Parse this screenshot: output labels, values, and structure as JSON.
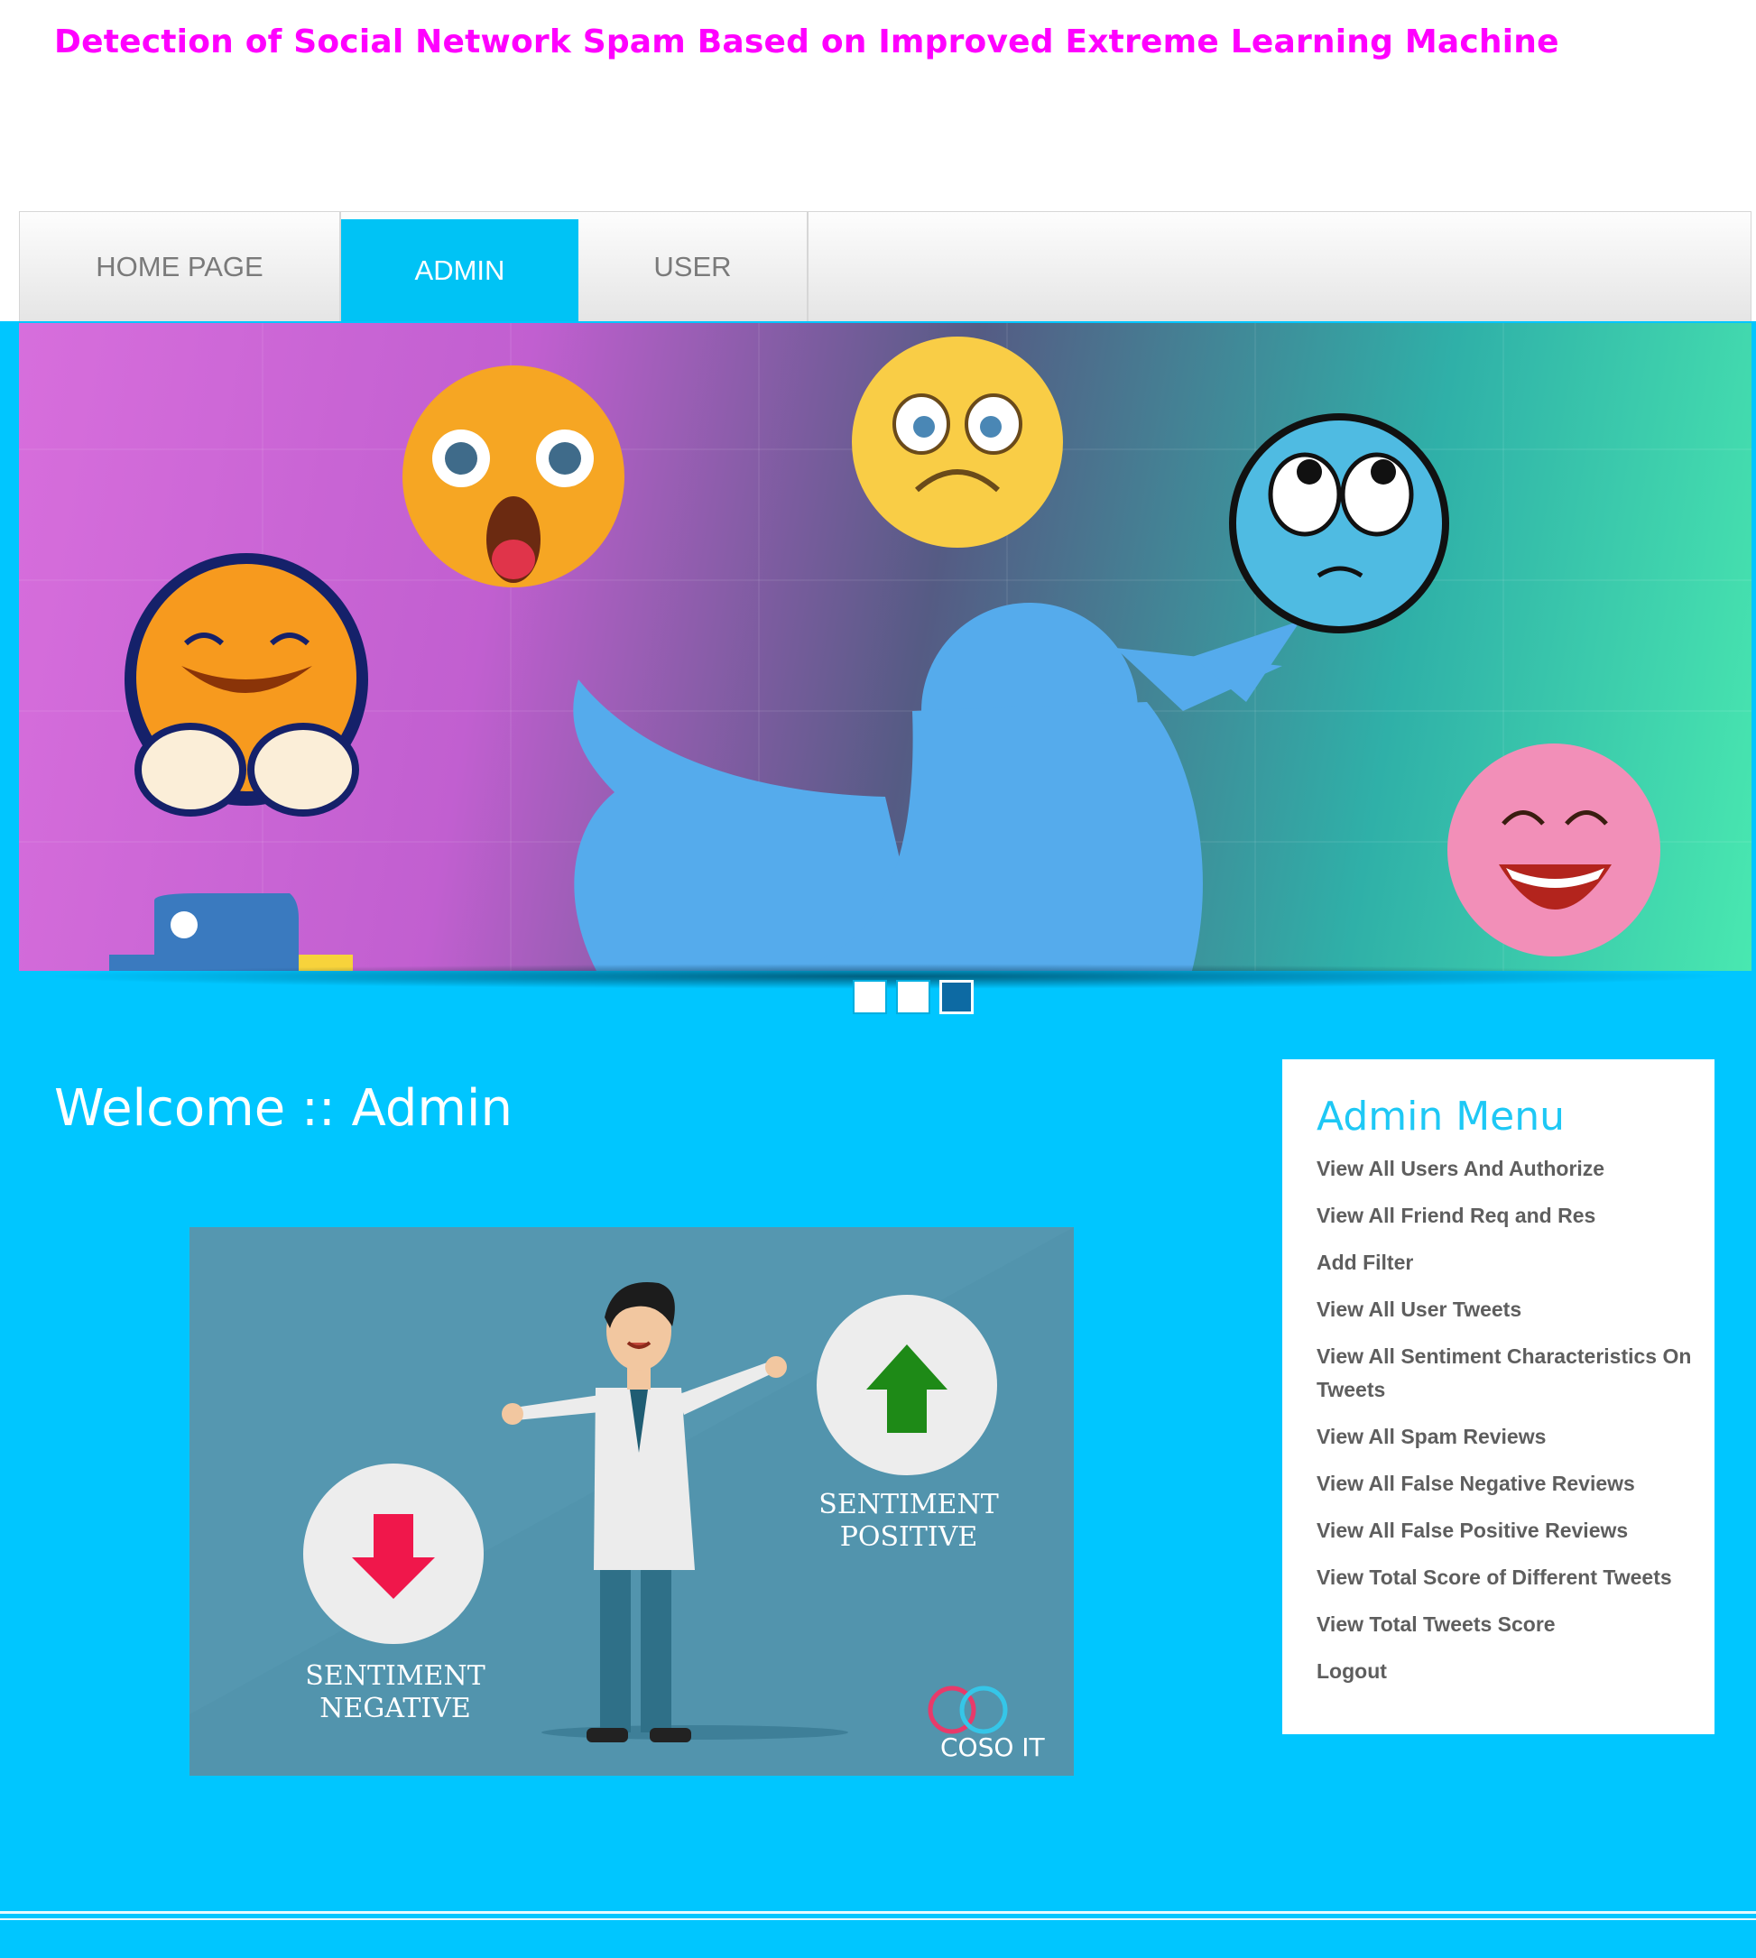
{
  "site": {
    "title": "Detection of Social Network Spam Based on Improved Extreme Learning Machine"
  },
  "nav": {
    "items": [
      {
        "label": "HOME PAGE"
      },
      {
        "label": "ADMIN"
      },
      {
        "label": "USER"
      }
    ],
    "active_index": 1
  },
  "slider": {
    "slide_count": 3,
    "active_index": 2
  },
  "welcome": {
    "text": "Welcome :: Admin"
  },
  "illustration": {
    "negative_label_line1": "SENTIMENT",
    "negative_label_line2": "NEGATIVE",
    "positive_label_line1": "SENTIMENT",
    "positive_label_line2": "POSITIVE",
    "logo_text": "COSO IT"
  },
  "admin_menu": {
    "title": "Admin Menu",
    "items": [
      {
        "label": "View All Users And Authorize"
      },
      {
        "label": "View All Friend Req and Res"
      },
      {
        "label": "Add Filter"
      },
      {
        "label": "View All User Tweets"
      },
      {
        "label": "View All Sentiment Characteristics On Tweets"
      },
      {
        "label": "View All Spam Reviews"
      },
      {
        "label": "View All False Negative Reviews"
      },
      {
        "label": "View All False Positive Reviews"
      },
      {
        "label": "View Total Score of Different Tweets"
      },
      {
        "label": "View Total Tweets Score"
      },
      {
        "label": "Logout"
      }
    ]
  },
  "colors": {
    "title": "#ff00ff",
    "accent": "#00c6ff",
    "nav_active": "#00c3f5",
    "menu_title": "#1ec8f5",
    "menu_text": "#5e5e5e"
  }
}
